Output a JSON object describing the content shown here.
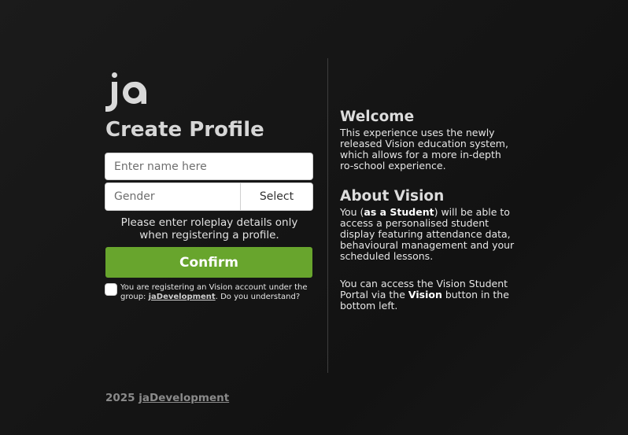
{
  "logo": {
    "text": "ja"
  },
  "form": {
    "title": "Create Profile",
    "name_placeholder": "Enter name here",
    "gender_placeholder": "Gender",
    "select_label": "Select",
    "hint": "Please enter roleplay details only when registering a profile.",
    "confirm_label": "Confirm",
    "consent": {
      "prefix": "You are registering an Vision account under the group: ",
      "group_link": "jaDevelopment",
      "suffix": ". Do you understand?"
    }
  },
  "info": {
    "welcome_title": "Welcome",
    "welcome_text": "This experience uses the newly released Vision education system, which allows for a more in-depth ro-school experience.",
    "about_title": "About Vision",
    "about_prefix": "You (",
    "about_bold": "as a Student",
    "about_suffix": ") will be able to access a personalised student display featuring attendance data, behavioural management and your scheduled lessons.",
    "portal_prefix": "You can access the Vision Student Portal via the ",
    "portal_bold": "Vision",
    "portal_suffix": " button in the bottom left."
  },
  "footer": {
    "year": "2025",
    "link": "jaDevelopment"
  },
  "colors": {
    "accent": "#68a52d",
    "background": "#161616"
  }
}
